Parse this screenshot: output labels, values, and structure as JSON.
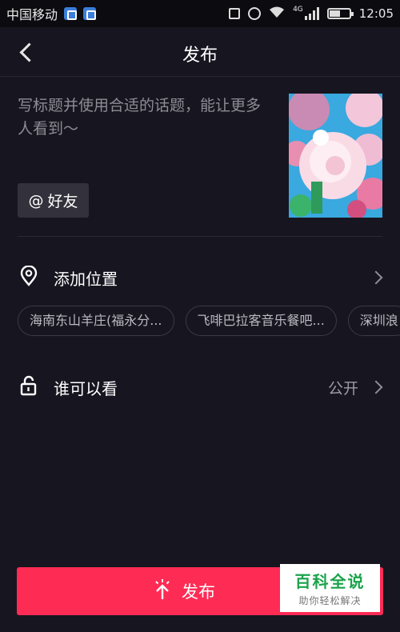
{
  "status_bar": {
    "carrier": "中国移动",
    "network": "4G",
    "time": "12:05",
    "icons": [
      "notification-app-icon",
      "gallery-app-icon",
      "vibrate-icon",
      "alarm-icon",
      "wifi-icon",
      "signal-icon",
      "battery-icon"
    ]
  },
  "header": {
    "back_icon": "chevron-left-icon",
    "title": "发布"
  },
  "composer": {
    "caption_placeholder": "写标题并使用合适的话题，能让更多人看到～",
    "mention_button_symbol": "@",
    "mention_button_label": "好友",
    "thumbnail": "cover-image-roses"
  },
  "location": {
    "icon": "location-pin-icon",
    "label": "添加位置",
    "suggestions": [
      "海南东山羊庄(福永分...",
      "飞啡巴拉客音乐餐吧...",
      "深圳浪"
    ]
  },
  "visibility": {
    "icon": "unlock-icon",
    "label": "谁可以看",
    "value": "公开"
  },
  "publish_button": {
    "icon": "sparkle-arrow-up-icon",
    "label": "发布"
  },
  "watermark": {
    "main": "百科全说",
    "sub": "助你轻松解决"
  },
  "colors": {
    "background": "#171620",
    "accent": "#fe2c55",
    "watermark_green": "#1aa34a"
  }
}
